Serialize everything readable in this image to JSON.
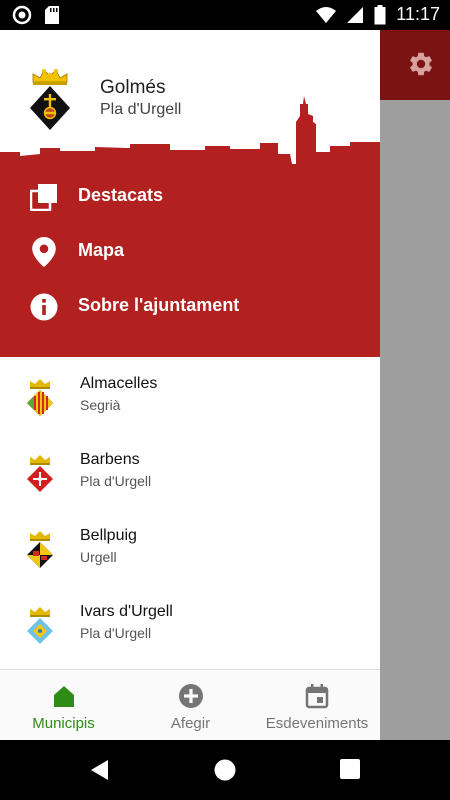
{
  "status_bar": {
    "time": "11:17",
    "icons": [
      "record-icon",
      "sd-card-icon",
      "wifi-icon",
      "signal-icon",
      "battery-icon"
    ]
  },
  "background_app": {
    "settings_icon": "gear-icon",
    "toolbar_color": "#7b1313"
  },
  "drawer": {
    "header": {
      "town_name": "Golmés",
      "region": "Pla d'Urgell",
      "accent_color": "#b22020"
    },
    "menu": [
      {
        "label": "Destacats",
        "icon": "copy-icon"
      },
      {
        "label": "Mapa",
        "icon": "location-pin-icon"
      },
      {
        "label": "Sobre l'ajuntament",
        "icon": "info-icon"
      }
    ]
  },
  "municipalities": [
    {
      "name": "Almacelles",
      "region": "Segrià"
    },
    {
      "name": "Barbens",
      "region": "Pla d'Urgell"
    },
    {
      "name": "Bellpuig",
      "region": "Urgell"
    },
    {
      "name": "Ivars d'Urgell",
      "region": "Pla d'Urgell"
    }
  ],
  "bottom_nav": {
    "tabs": [
      {
        "label": "Municipis",
        "icon": "home-icon",
        "active": true
      },
      {
        "label": "Afegir",
        "icon": "add-circle-icon",
        "active": false
      },
      {
        "label": "Esdeveniments",
        "icon": "calendar-icon",
        "active": false
      }
    ],
    "active_color": "#2e8b18"
  },
  "system_nav": {
    "buttons": [
      "back-icon",
      "home-circle-icon",
      "recents-icon"
    ]
  }
}
